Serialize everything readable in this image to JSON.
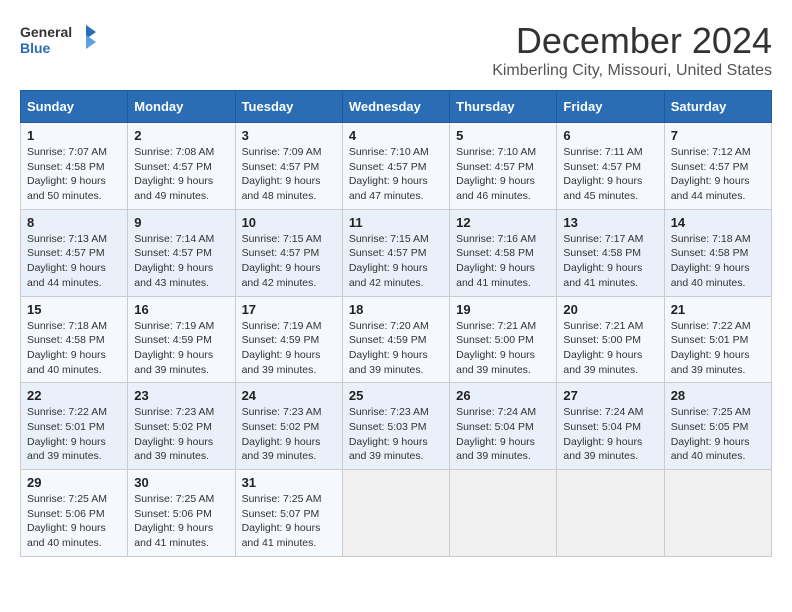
{
  "logo": {
    "line1": "General",
    "line2": "Blue"
  },
  "title": "December 2024",
  "location": "Kimberling City, Missouri, United States",
  "weekdays": [
    "Sunday",
    "Monday",
    "Tuesday",
    "Wednesday",
    "Thursday",
    "Friday",
    "Saturday"
  ],
  "weeks": [
    [
      {
        "day": "1",
        "sunrise": "7:07 AM",
        "sunset": "4:58 PM",
        "daylight": "9 hours and 50 minutes."
      },
      {
        "day": "2",
        "sunrise": "7:08 AM",
        "sunset": "4:57 PM",
        "daylight": "9 hours and 49 minutes."
      },
      {
        "day": "3",
        "sunrise": "7:09 AM",
        "sunset": "4:57 PM",
        "daylight": "9 hours and 48 minutes."
      },
      {
        "day": "4",
        "sunrise": "7:10 AM",
        "sunset": "4:57 PM",
        "daylight": "9 hours and 47 minutes."
      },
      {
        "day": "5",
        "sunrise": "7:10 AM",
        "sunset": "4:57 PM",
        "daylight": "9 hours and 46 minutes."
      },
      {
        "day": "6",
        "sunrise": "7:11 AM",
        "sunset": "4:57 PM",
        "daylight": "9 hours and 45 minutes."
      },
      {
        "day": "7",
        "sunrise": "7:12 AM",
        "sunset": "4:57 PM",
        "daylight": "9 hours and 44 minutes."
      }
    ],
    [
      {
        "day": "8",
        "sunrise": "7:13 AM",
        "sunset": "4:57 PM",
        "daylight": "9 hours and 44 minutes."
      },
      {
        "day": "9",
        "sunrise": "7:14 AM",
        "sunset": "4:57 PM",
        "daylight": "9 hours and 43 minutes."
      },
      {
        "day": "10",
        "sunrise": "7:15 AM",
        "sunset": "4:57 PM",
        "daylight": "9 hours and 42 minutes."
      },
      {
        "day": "11",
        "sunrise": "7:15 AM",
        "sunset": "4:57 PM",
        "daylight": "9 hours and 42 minutes."
      },
      {
        "day": "12",
        "sunrise": "7:16 AM",
        "sunset": "4:58 PM",
        "daylight": "9 hours and 41 minutes."
      },
      {
        "day": "13",
        "sunrise": "7:17 AM",
        "sunset": "4:58 PM",
        "daylight": "9 hours and 41 minutes."
      },
      {
        "day": "14",
        "sunrise": "7:18 AM",
        "sunset": "4:58 PM",
        "daylight": "9 hours and 40 minutes."
      }
    ],
    [
      {
        "day": "15",
        "sunrise": "7:18 AM",
        "sunset": "4:58 PM",
        "daylight": "9 hours and 40 minutes."
      },
      {
        "day": "16",
        "sunrise": "7:19 AM",
        "sunset": "4:59 PM",
        "daylight": "9 hours and 39 minutes."
      },
      {
        "day": "17",
        "sunrise": "7:19 AM",
        "sunset": "4:59 PM",
        "daylight": "9 hours and 39 minutes."
      },
      {
        "day": "18",
        "sunrise": "7:20 AM",
        "sunset": "4:59 PM",
        "daylight": "9 hours and 39 minutes."
      },
      {
        "day": "19",
        "sunrise": "7:21 AM",
        "sunset": "5:00 PM",
        "daylight": "9 hours and 39 minutes."
      },
      {
        "day": "20",
        "sunrise": "7:21 AM",
        "sunset": "5:00 PM",
        "daylight": "9 hours and 39 minutes."
      },
      {
        "day": "21",
        "sunrise": "7:22 AM",
        "sunset": "5:01 PM",
        "daylight": "9 hours and 39 minutes."
      }
    ],
    [
      {
        "day": "22",
        "sunrise": "7:22 AM",
        "sunset": "5:01 PM",
        "daylight": "9 hours and 39 minutes."
      },
      {
        "day": "23",
        "sunrise": "7:23 AM",
        "sunset": "5:02 PM",
        "daylight": "9 hours and 39 minutes."
      },
      {
        "day": "24",
        "sunrise": "7:23 AM",
        "sunset": "5:02 PM",
        "daylight": "9 hours and 39 minutes."
      },
      {
        "day": "25",
        "sunrise": "7:23 AM",
        "sunset": "5:03 PM",
        "daylight": "9 hours and 39 minutes."
      },
      {
        "day": "26",
        "sunrise": "7:24 AM",
        "sunset": "5:04 PM",
        "daylight": "9 hours and 39 minutes."
      },
      {
        "day": "27",
        "sunrise": "7:24 AM",
        "sunset": "5:04 PM",
        "daylight": "9 hours and 39 minutes."
      },
      {
        "day": "28",
        "sunrise": "7:25 AM",
        "sunset": "5:05 PM",
        "daylight": "9 hours and 40 minutes."
      }
    ],
    [
      {
        "day": "29",
        "sunrise": "7:25 AM",
        "sunset": "5:06 PM",
        "daylight": "9 hours and 40 minutes."
      },
      {
        "day": "30",
        "sunrise": "7:25 AM",
        "sunset": "5:06 PM",
        "daylight": "9 hours and 41 minutes."
      },
      {
        "day": "31",
        "sunrise": "7:25 AM",
        "sunset": "5:07 PM",
        "daylight": "9 hours and 41 minutes."
      },
      null,
      null,
      null,
      null
    ]
  ],
  "labels": {
    "sunrise": "Sunrise:",
    "sunset": "Sunset:",
    "daylight": "Daylight:"
  }
}
